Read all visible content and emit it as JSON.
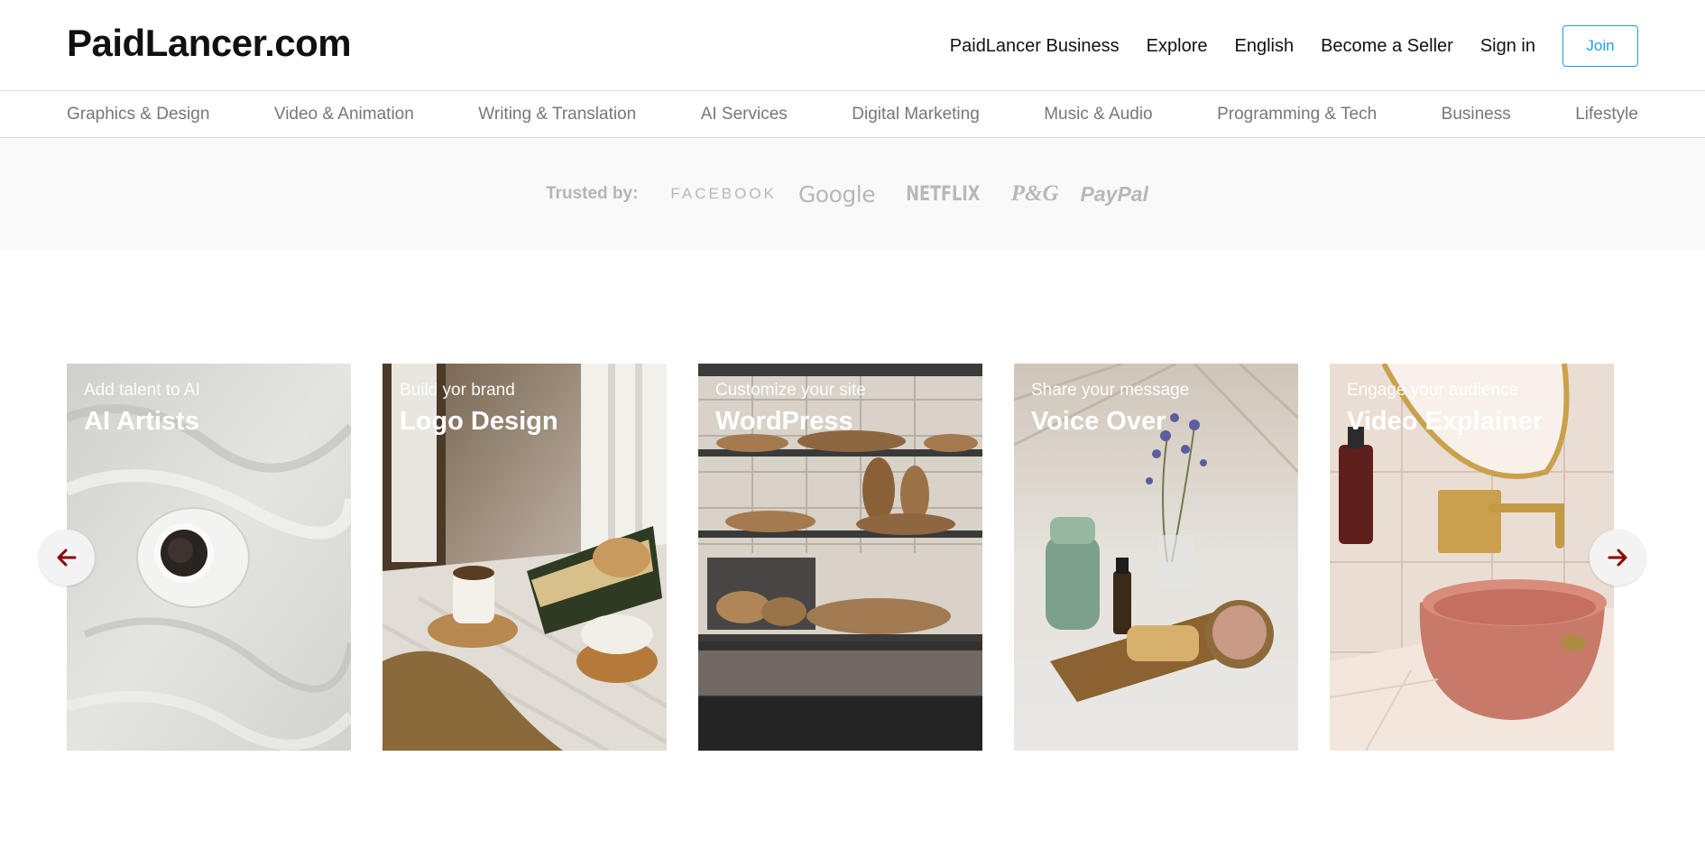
{
  "header": {
    "logo": "PaidLancer.com",
    "nav": [
      "PaidLancer Business",
      "Explore",
      "English",
      "Become a Seller",
      "Sign in"
    ],
    "join_label": "Join"
  },
  "categories": [
    "Graphics & Design",
    "Video & Animation",
    "Writing & Translation",
    "AI Services",
    "Digital Marketing",
    "Music & Audio",
    "Programming & Tech",
    "Business",
    "Lifestyle"
  ],
  "trusted": {
    "label": "Trusted by:",
    "brands": [
      "FACEBOOK",
      "Google",
      "NETFLIX",
      "P&G",
      "PayPal"
    ]
  },
  "cards": [
    {
      "subtitle": "Add talent to AI",
      "title": "AI Artists",
      "image": "coffee-cup-on-bedsheet"
    },
    {
      "subtitle": "Build yor brand",
      "title": "Logo Design",
      "image": "coffee-and-books-on-shelf"
    },
    {
      "subtitle": "Customize your site",
      "title": "WordPress",
      "image": "bakery-bread-shelves"
    },
    {
      "subtitle": "Share your message",
      "title": "Voice Over",
      "image": "bath-tray-with-flowers"
    },
    {
      "subtitle": "Engage your audience",
      "title": "Video Explainer",
      "image": "pink-sink-gold-faucet"
    }
  ],
  "colors": {
    "accent": "#1aa0e6",
    "arrow": "#8b0000",
    "muted_text": "#777777"
  },
  "icons": {
    "prev": "arrow-left-icon",
    "next": "arrow-right-icon"
  }
}
